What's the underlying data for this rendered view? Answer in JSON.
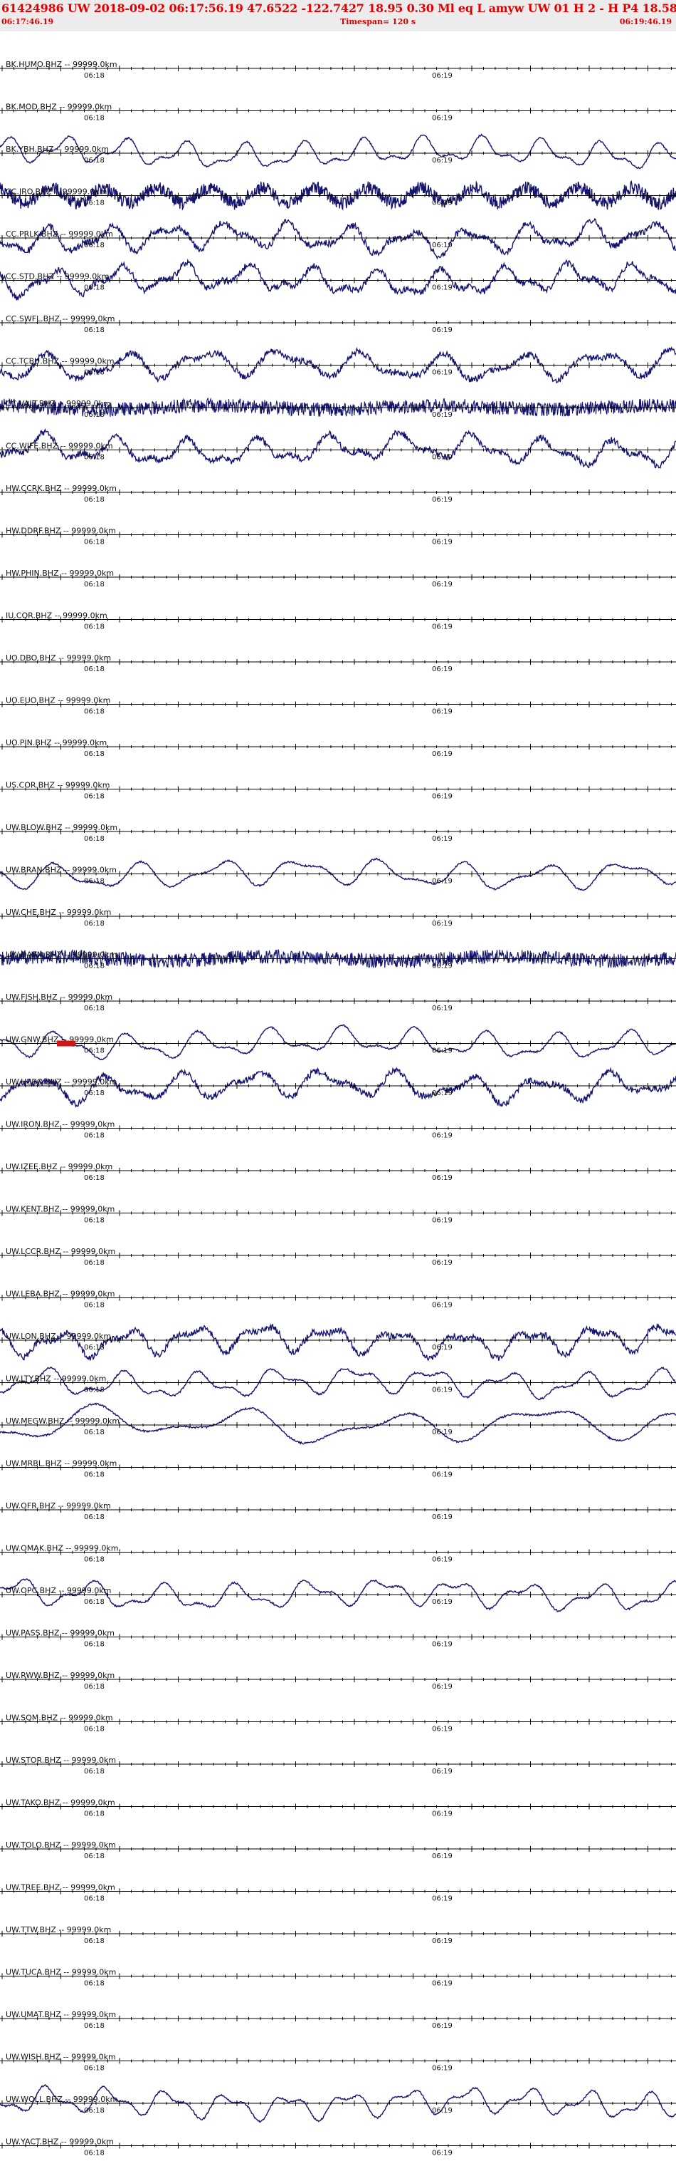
{
  "header": {
    "title": "61424986 UW 2018-09-02 06:17:56.19   47.6522 -122.7427  18.95  0.30 Ml  eq  L amyw     UW 01  H   2   -   H P4    18.58  0.37",
    "start_time": "06:17:46.19",
    "timespan": "Timespan= 120 s",
    "end_time": "06:19:46.19"
  },
  "colors": {
    "header_text": "#e00000",
    "trace": "#14146e",
    "pick": "#d21414",
    "axis": "#000000"
  },
  "tick_labels": {
    "first": "06:18",
    "second": "06:19"
  },
  "channels": [
    {
      "label": "BK.HUMO.BHZ -- 99999.0km",
      "has_data": false
    },
    {
      "label": "BK.MOD.BHZ -- 99999.0km",
      "has_data": false
    },
    {
      "label": "BK.YBH.BHZ -- 99999.0km",
      "has_data": true,
      "character": "long-period"
    },
    {
      "label": "CC.JRO.BHZ -- 99999.0km",
      "has_data": true,
      "character": "noisy"
    },
    {
      "label": "CC.PRLK.BHZ -- 99999.0km",
      "has_data": true,
      "character": "long-period-noisy"
    },
    {
      "label": "CC.STD.BHZ -- 99999.0km",
      "has_data": true,
      "character": "long-period-noisy"
    },
    {
      "label": "CC.SWFL.BHZ -- 99999.0km",
      "has_data": false
    },
    {
      "label": "CC.TCBU.BHZ -- 99999.0km",
      "has_data": true,
      "character": "long-period-noisy"
    },
    {
      "label": "CC.VALT.BHZ -- 99999.0km",
      "has_data": true,
      "character": "high-frequency"
    },
    {
      "label": "CC.WIFE.BHZ -- 99999.0km",
      "has_data": true,
      "character": "long-period-noisy"
    },
    {
      "label": "HW.CCRK.BHZ -- 99999.0km",
      "has_data": false
    },
    {
      "label": "HW.DDRF.BHZ -- 99999.0km",
      "has_data": false
    },
    {
      "label": "HW.PHIN.BHZ -- 99999.0km",
      "has_data": false
    },
    {
      "label": "IU.COR.BHZ -- 99999.0km",
      "has_data": false
    },
    {
      "label": "UO.DBO.BHZ -- 99999.0km",
      "has_data": false
    },
    {
      "label": "UO.EUO.BHZ -- 99999.0km",
      "has_data": false
    },
    {
      "label": "UO.PIN.BHZ -- 99999.0km",
      "has_data": false
    },
    {
      "label": "US.COR.BHZ -- 99999.0km",
      "has_data": false
    },
    {
      "label": "UW.BLOW.BHZ -- 99999.0km",
      "has_data": false
    },
    {
      "label": "UW.BRAN.BHZ -- 99999.0km",
      "has_data": true,
      "character": "long-period"
    },
    {
      "label": "UW.CHE.BHZ -- 99999.0km",
      "has_data": false
    },
    {
      "label": "UW.DAVN.BHZ -- 99999.0km",
      "has_data": true,
      "character": "high-frequency"
    },
    {
      "label": "UW.FISH.BHZ -- 99999.0km",
      "has_data": false
    },
    {
      "label": "UW.GNW.BHZ -- 99999.0km",
      "has_data": true,
      "character": "long-period",
      "pick": true
    },
    {
      "label": "UW.HEBO.BHZ -- 99999.0km",
      "has_data": true,
      "character": "long-period-noisy"
    },
    {
      "label": "UW.IRON.BHZ -- 99999.0km",
      "has_data": false
    },
    {
      "label": "UW.IZEE.BHZ -- 99999.0km",
      "has_data": false
    },
    {
      "label": "UW.KENT.BHZ -- 99999.0km",
      "has_data": false
    },
    {
      "label": "UW.LCCR.BHZ -- 99999.0km",
      "has_data": false
    },
    {
      "label": "UW.LEBA.BHZ -- 99999.0km",
      "has_data": false
    },
    {
      "label": "UW.LON.BHZ -- 99999.0km",
      "has_data": true,
      "character": "long-period-noisy"
    },
    {
      "label": "UW.LTY.BHZ -- 99999.0km",
      "has_data": true,
      "character": "long-period"
    },
    {
      "label": "UW.MEGW.BHZ -- 99999.0km",
      "has_data": true,
      "character": "very-long-period"
    },
    {
      "label": "UW.MRBL.BHZ -- 99999.0km",
      "has_data": false
    },
    {
      "label": "UW.OFR.BHZ -- 99999.0km",
      "has_data": false
    },
    {
      "label": "UW.OMAK.BHZ -- 99999.0km",
      "has_data": false
    },
    {
      "label": "UW.OPC.BHZ -- 99999.0km",
      "has_data": true,
      "character": "long-period"
    },
    {
      "label": "UW.PASS.BHZ -- 99999.0km",
      "has_data": false
    },
    {
      "label": "UW.RWW.BHZ -- 99999.0km",
      "has_data": false
    },
    {
      "label": "UW.SQM.BHZ -- 99999.0km",
      "has_data": false
    },
    {
      "label": "UW.STOR.BHZ -- 99999.0km",
      "has_data": false
    },
    {
      "label": "UW.TAKO.BHZ -- 99999.0km",
      "has_data": false
    },
    {
      "label": "UW.TOLO.BHZ -- 99999.0km",
      "has_data": false
    },
    {
      "label": "UW.TREE.BHZ -- 99999.0km",
      "has_data": false
    },
    {
      "label": "UW.TTW.BHZ -- 99999.0km",
      "has_data": false
    },
    {
      "label": "UW.TUCA.BHZ -- 99999.0km",
      "has_data": false
    },
    {
      "label": "UW.UMAT.BHZ -- 99999.0km",
      "has_data": false
    },
    {
      "label": "UW.WISH.BHZ -- 99999.0km",
      "has_data": false
    },
    {
      "label": "UW.WOLL.BHZ -- 99999.0km",
      "has_data": true,
      "character": "long-period"
    },
    {
      "label": "UW.YACT.BHZ -- 99999.0km",
      "has_data": false
    }
  ]
}
